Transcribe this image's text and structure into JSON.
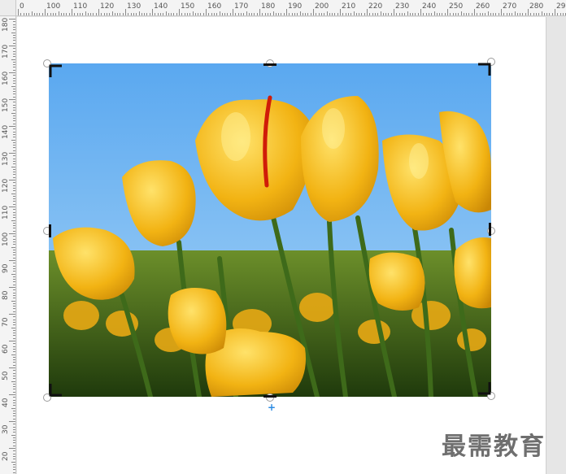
{
  "ruler": {
    "top_labels": [
      "0",
      "100",
      "110",
      "120",
      "130",
      "140",
      "150",
      "160",
      "170",
      "180",
      "190",
      "200",
      "210",
      "220",
      "230",
      "240",
      "250",
      "260",
      "270",
      "280",
      "290"
    ],
    "left_labels": [
      "180",
      "170",
      "160",
      "150",
      "140",
      "130",
      "120",
      "110",
      "100",
      "90",
      "80",
      "70",
      "60",
      "50",
      "40",
      "30",
      "20"
    ]
  },
  "image": {
    "subject": "yellow tulips against blue sky",
    "selected": true
  },
  "rotate_handle_glyph": "+",
  "watermark": "最需教育",
  "colors": {
    "sky": "#6fb6f0",
    "tulip": "#f2b313",
    "grass": "#3f6b1e",
    "ruler_bg": "#f4f4f4",
    "rotate_accent": "#2a8ae2"
  }
}
